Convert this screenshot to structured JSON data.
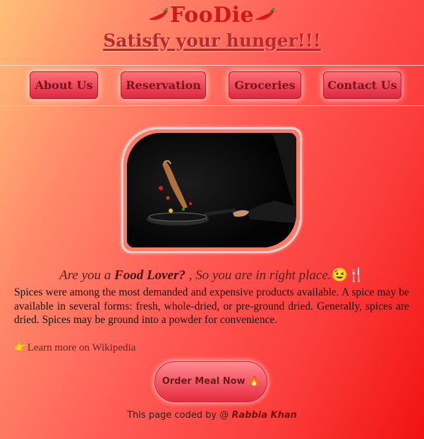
{
  "header": {
    "brand": "FooDie",
    "tagline": "Satisfy your hunger!!!"
  },
  "nav": {
    "items": [
      "About Us",
      "Reservation",
      "Groceries",
      "Contact Us"
    ]
  },
  "intro": {
    "prefix": "Are you a ",
    "highlight": "Food Lover?",
    "suffix": " , So you are in right place.",
    "emoji": "😉🍴"
  },
  "description": "Spices were among the most demanded and expensive products available. A spice may be available in several forms: fresh, whole-dried, or pre-ground dried. Generally, spices are dried. Spices may be ground into a powder for convenience.",
  "wiki": {
    "icon": "👉",
    "label": "Learn more on Wikipedia"
  },
  "order": {
    "label": "Order Meal Now",
    "icon": "🔥"
  },
  "footer": {
    "prefix": "This page coded by @ ",
    "author": "Rabbia Khan"
  },
  "colors": {
    "brand": "#cc1a1a",
    "nav_button": "#e23545",
    "hero_frame": "#ff7a64"
  }
}
